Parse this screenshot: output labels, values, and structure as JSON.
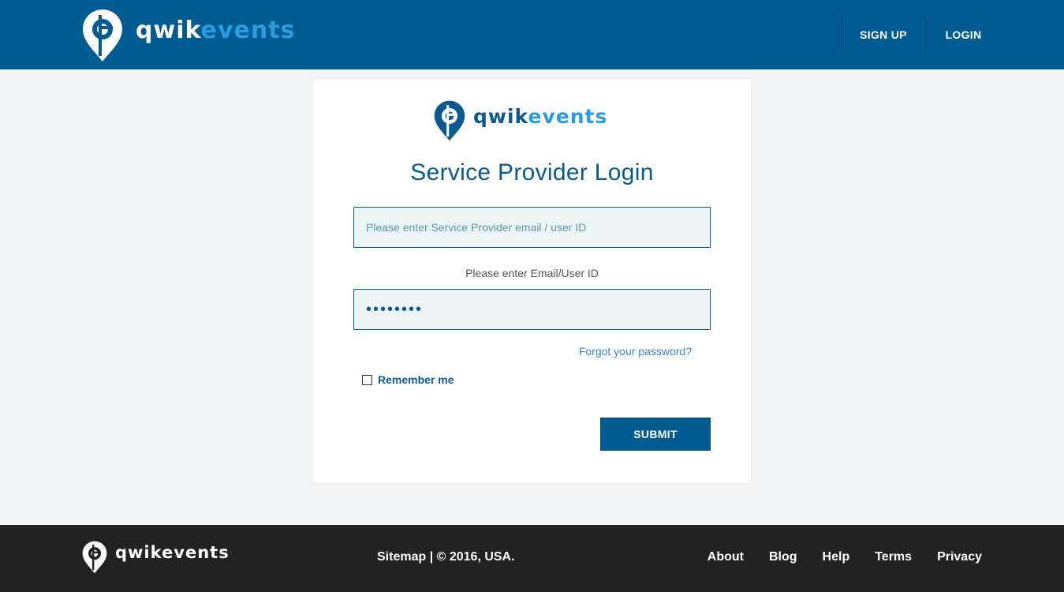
{
  "brand": {
    "name_part1": "qwik",
    "name_part2": "events",
    "color_primary": "#005b92",
    "color_accent": "#2a9de0"
  },
  "header": {
    "nav": {
      "signup_label": "SIGN UP",
      "login_label": "LOGIN"
    }
  },
  "login": {
    "title": "Service Provider Login",
    "email_placeholder": "Please enter Service Provider email / user ID",
    "email_hint": "Please enter Email/User ID",
    "password_value": "••••••••",
    "forgot_label": "Forgot your password?",
    "remember_label": "Remember me",
    "submit_label": "SUBMIT"
  },
  "footer": {
    "copyright": "Sitemap | © 2016, USA.",
    "links": [
      "About",
      "Blog",
      "Help",
      "Terms",
      "Privacy"
    ]
  }
}
